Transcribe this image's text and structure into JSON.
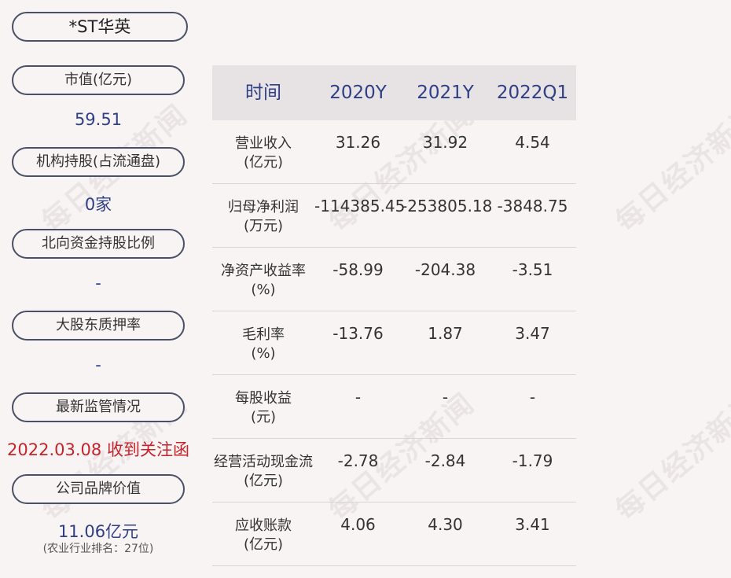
{
  "stock": {
    "name": "*ST华英"
  },
  "watermark": "每日经济新闻",
  "metrics": {
    "market_cap_label": "市值(亿元)",
    "market_cap_value": "59.51",
    "institution_label": "机构持股(占流通盘)",
    "institution_value": "0家",
    "northbound_label": "北向资金持股比例",
    "northbound_value": "-",
    "pledge_label": "大股东质押率",
    "pledge_value": "-",
    "regulation_label": "最新监管情况",
    "regulation_value": "2022.03.08 收到关注函",
    "brand_label": "公司品牌价值",
    "brand_value": "11.06亿元",
    "brand_note": "(农业行业排名：27位)"
  },
  "table": {
    "headers": [
      "时间",
      "2020Y",
      "2021Y",
      "2022Q1"
    ],
    "rows": [
      {
        "label": [
          "营业收入",
          "(亿元)"
        ],
        "values": [
          "31.26",
          "31.92",
          "4.54"
        ]
      },
      {
        "label": [
          "归母净利润",
          "(万元)"
        ],
        "values": [
          "-114385.45",
          "-253805.18",
          "-3848.75"
        ]
      },
      {
        "label": [
          "净资产收益率",
          "(%)"
        ],
        "values": [
          "-58.99",
          "-204.38",
          "-3.51"
        ]
      },
      {
        "label": [
          "毛利率",
          "(%)"
        ],
        "values": [
          "-13.76",
          "1.87",
          "3.47"
        ]
      },
      {
        "label": [
          "每股收益",
          "(元)"
        ],
        "values": [
          "-",
          "-",
          "-"
        ]
      },
      {
        "label": [
          "经营活动现金流",
          "(亿元)"
        ],
        "values": [
          "-2.78",
          "-2.84",
          "-1.79"
        ]
      },
      {
        "label": [
          "应收账款",
          "(亿元)"
        ],
        "values": [
          "4.06",
          "4.30",
          "3.41"
        ]
      }
    ]
  },
  "colors": {
    "background": "#f8f4f4",
    "accent_blue": "#2f3f86",
    "alert_red": "#c8222a",
    "header_bg": "#e7e2e3",
    "pill_border": "#4a5066"
  }
}
